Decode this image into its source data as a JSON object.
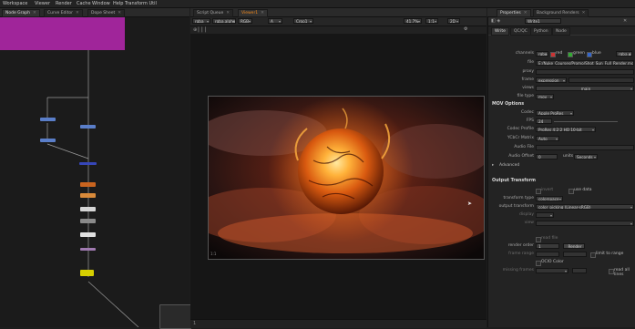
{
  "menu": [
    "Workspace",
    "Viewer",
    "Render",
    "Cache",
    "Window",
    "Help",
    "Transform Util"
  ],
  "left_tabs": [
    "Node Graph",
    "Curve Editor",
    "Dope Sheet"
  ],
  "center_tabs": [
    "Script Queue",
    "Viewer1"
  ],
  "right_tabs": [
    "Properties",
    "Background Renders"
  ],
  "viewer_toolbar": {
    "channels": "rgba",
    "layer": "rgba.alpha",
    "colorspace": "RGB",
    "gain": "A",
    "input": "Crop1",
    "zoom": "41.7%",
    "ratio": "1:1",
    "mode": "2D"
  },
  "viewer_info": {
    "format": "1:1",
    "frame": "1"
  },
  "props": {
    "node_name": "Write1",
    "tabs": [
      "Write",
      "QC/QC",
      "Python",
      "Node"
    ],
    "channels_label": "channels",
    "channels_value": "rgba",
    "chk_red": "red",
    "chk_green": "green",
    "chk_blue": "blue",
    "chk_alpha": "rgba.alpha",
    "file_label": "file",
    "file_value": "E:/Nuke_Courses/Promo/Shot_Sun_Full_Render.mov",
    "proxy_label": "proxy",
    "frame_label": "frame",
    "frame_value": "expression",
    "views_label": "views",
    "views_value": "main",
    "filetype_label": "file type",
    "filetype_value": "mov",
    "section_mov": "MOV Options",
    "codec_label": "Codec",
    "codec_value": "Apple ProRes",
    "fps_label": "FPS",
    "fps_value": "24",
    "codec_profile_label": "Codec Profile",
    "codec_profile_value": "ProRes 4:2:2 HQ 10-bit",
    "ycbcr_label": "YCbCr Matrix",
    "ycbcr_value": "Auto",
    "audio_file_label": "Audio File",
    "audio_offset_label": "Audio Offset",
    "audio_offset_value": "0",
    "units_label": "units",
    "units_value": "Seconds",
    "advanced_label": "Advanced",
    "section_output": "Output Transform",
    "reverse_label": "invert",
    "use_data_label": "use data",
    "transform_type_label": "transform type",
    "transform_type_value": "colorspace",
    "output_transform_label": "output transform",
    "output_transform_value": "color_picking (Linear-sRGB)",
    "display_label": "display",
    "view_label": "view",
    "render_order_label": "render order",
    "render_order_value": "1",
    "render_btn": "Render",
    "limit_label": "limit to range",
    "frame_range_label": "frame range",
    "read_file_label": "read file",
    "missing_label": "missing frames",
    "read_all_label": "read all lines",
    "ocio_label": "OCIO Color"
  },
  "colors": {
    "accent": "#f28a1e",
    "node_write": "#d6cf00",
    "node_magenta": "#a0259a"
  }
}
